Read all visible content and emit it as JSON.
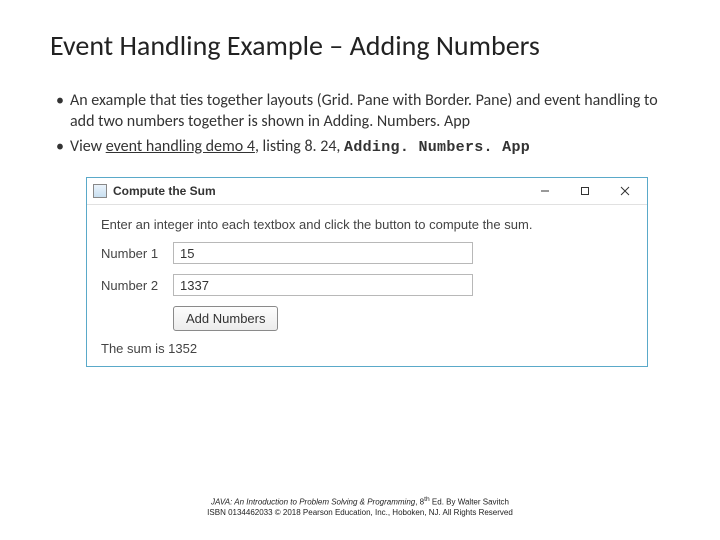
{
  "title": "Event Handling Example – Adding Numbers",
  "bullets": {
    "b1": "An example that ties together layouts (Grid. Pane with Border. Pane) and event handling to add two numbers together is shown in Adding. Numbers. App",
    "b2_prefix": "View ",
    "b2_link": "event handling demo 4",
    "b2_mid": ", listing 8. 24, ",
    "b2_code": "Adding. Numbers. App"
  },
  "window": {
    "title": "Compute the Sum",
    "instruction": "Enter an integer into each textbox and click the button to compute the sum.",
    "label1": "Number 1",
    "value1": "15",
    "label2": "Number 2",
    "value2": "1337",
    "button": "Add Numbers",
    "result": "The sum is 1352"
  },
  "footer": {
    "line1a": "JAVA: An Introduction to Problem Solving & Programming",
    "line1b": ", 8",
    "line1c": "th",
    "line1d": " Ed. By Walter Savitch",
    "line2": "ISBN 0134462033 © 2018 Pearson Education, Inc., Hoboken, NJ. All Rights Reserved"
  }
}
